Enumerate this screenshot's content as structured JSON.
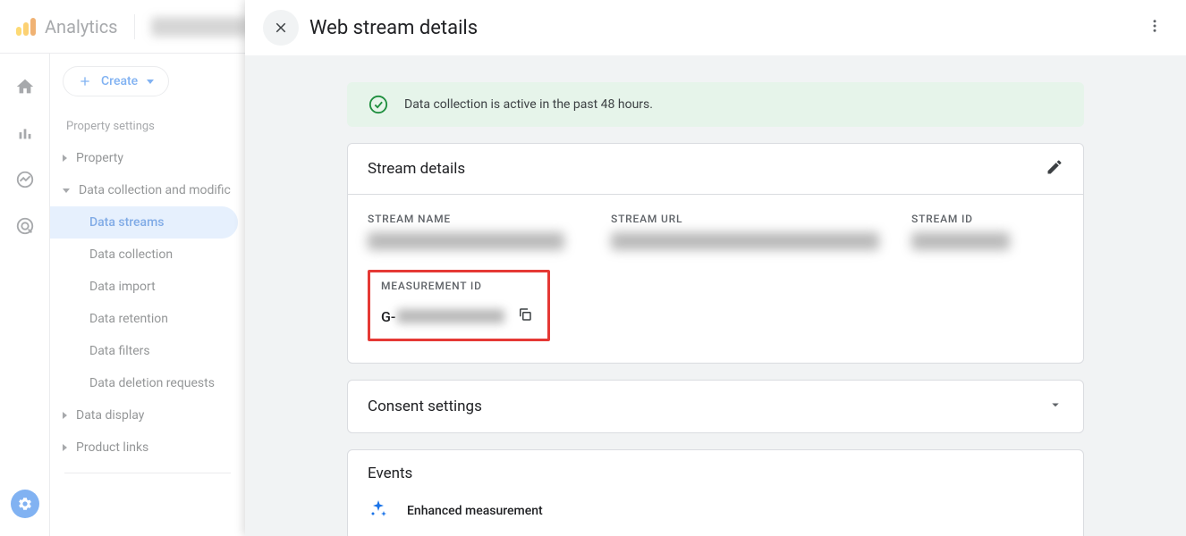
{
  "header": {
    "brand": "Analytics"
  },
  "sidebar": {
    "create_label": "Create",
    "section_label": "Property settings",
    "property_label": "Property",
    "datacoll_group_label": "Data collection and modific",
    "items": {
      "data_streams": "Data streams",
      "data_collection": "Data collection",
      "data_import": "Data import",
      "data_retention": "Data retention",
      "data_filters": "Data filters",
      "data_deletion": "Data deletion requests"
    },
    "data_display_label": "Data display",
    "product_links_label": "Product links"
  },
  "panel": {
    "title": "Web stream details",
    "banner_text": "Data collection is active in the past 48 hours.",
    "stream_details": {
      "title": "Stream details",
      "labels": {
        "name": "STREAM NAME",
        "url": "STREAM URL",
        "id": "STREAM ID",
        "mid": "MEASUREMENT ID"
      },
      "measurement_id_prefix": "G-"
    },
    "consent_title": "Consent settings",
    "events": {
      "title": "Events",
      "enhanced_label": "Enhanced measurement"
    }
  }
}
